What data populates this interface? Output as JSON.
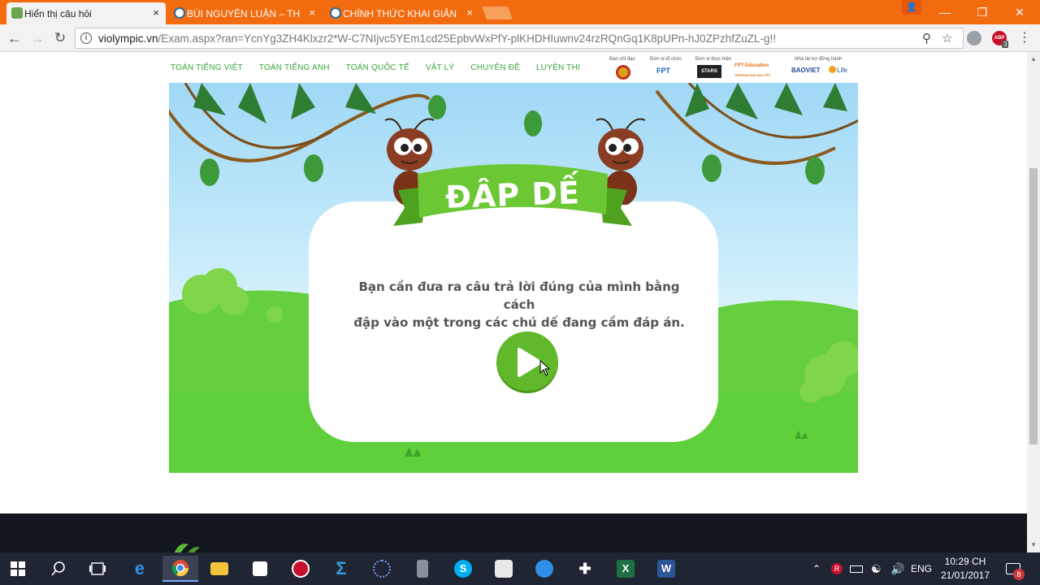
{
  "browser": {
    "tabs": [
      {
        "title": "Hiển thị câu hỏi",
        "active": true,
        "icon": "violympic-favicon"
      },
      {
        "title": "BÙI NGUYÊN LUẬN – TH",
        "active": false,
        "icon": "wordpress-favicon"
      },
      {
        "title": "CHÍNH THỨC KHAI GIẢN",
        "active": false,
        "icon": "wordpress-favicon"
      }
    ],
    "close_glyph": "×",
    "url_domain": "violympic.vn",
    "url_path": "/Exam.aspx?ran=YcnYg3ZH4Klxzr2*W-C7NIjvc5YEm1cd25EpbvWxPfY-plKHDHIuwnv24rzRQnGq1K8pUPn-hJ0ZPzhfZuZL-g!!",
    "abp_label": "ABP",
    "abp_count": "3",
    "user_glyph": "👤"
  },
  "site_nav": {
    "items": [
      "TOÁN TIẾNG VIỆT",
      "TOÁN TIẾNG ANH",
      "TOÁN QUỐC TẾ",
      "VẬT LÝ",
      "CHUYÊN ĐỀ",
      "LUYỆN THI"
    ]
  },
  "sponsors": {
    "labels": [
      "Ban chỉ đạo",
      "Đơn vị tổ chức",
      "Đơn vị thực hiện",
      "Nhà tài trợ đồng hành"
    ],
    "logos": [
      "FPT",
      "STARS",
      "FPT Education",
      "BAOVIET",
      "Life"
    ],
    "fpt_school": "TRƯỜNG ĐẠI HỌC FPT"
  },
  "game": {
    "title": "ĐẬP DẾ",
    "instruction_line1": "Bạn cần đưa ra câu trả lời đúng của mình bằng cách",
    "instruction_line2": "đập vào một trong các chú dế đang cầm đáp án.",
    "play_icon": "play-icon",
    "colors": {
      "banner": "#6cc735",
      "banner_dark": "#4ea21f",
      "grass": "#5fcf3c",
      "play": "#62b82b"
    }
  },
  "taskbar": {
    "language": "ENG",
    "time": "10:29 CH",
    "date": "21/01/2017",
    "notification_count": "8",
    "apps": [
      "start",
      "search",
      "task-view",
      "edge",
      "chrome",
      "file-explorer",
      "store",
      "recorder",
      "sigma",
      "lasso",
      "calculator",
      "skype",
      "camera",
      "network-globe",
      "tool",
      "excel",
      "word"
    ]
  }
}
